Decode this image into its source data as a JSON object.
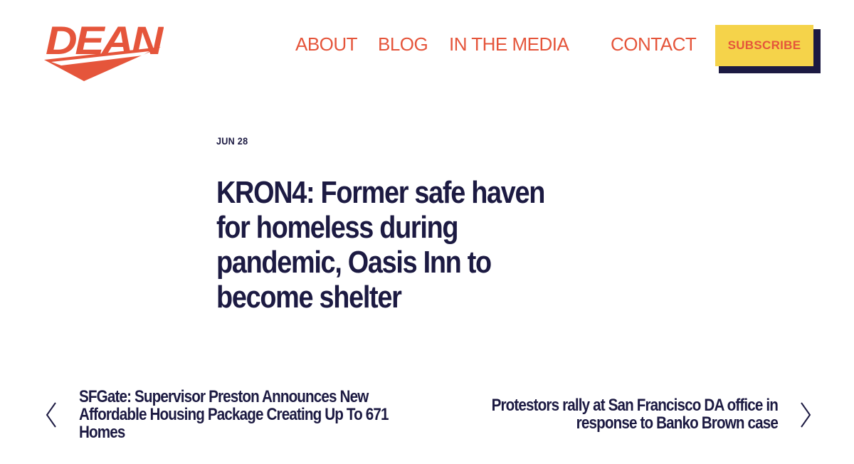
{
  "brand": {
    "logo_text": "DEAN",
    "accent_color": "#e5553b",
    "navy_color": "#1c1a42",
    "yellow_color": "#f5d34a"
  },
  "nav": {
    "items": [
      {
        "label": "ABOUT"
      },
      {
        "label": "BLOG"
      },
      {
        "label": "IN THE MEDIA"
      },
      {
        "label": "CONTACT"
      }
    ],
    "subscribe_label": "SUBSCRIBE"
  },
  "post": {
    "date": "JUN 28",
    "title": "KRON4: Former safe haven for homeless during pandemic, Oasis Inn to become shelter"
  },
  "pagination": {
    "prev": {
      "icon": "chevron-left-icon",
      "title": "SFGate: Supervisor Preston Announces New Affordable Housing Package Creating Up To 671 Homes"
    },
    "next": {
      "icon": "chevron-right-icon",
      "title": "Protestors rally at San Francisco DA office in response to Banko Brown case"
    }
  }
}
